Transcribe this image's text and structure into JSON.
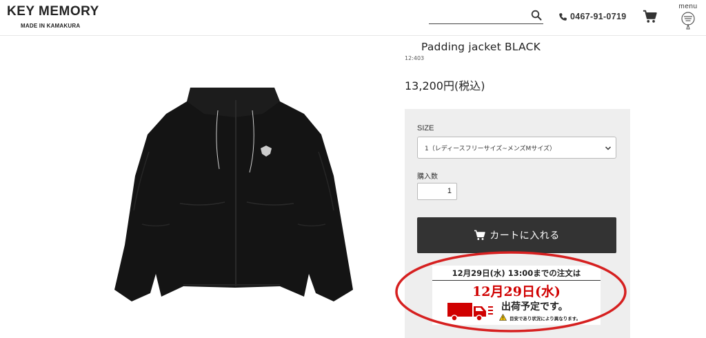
{
  "header": {
    "logo_title": "KEY MEMORY",
    "logo_subtitle": "MADE IN KAMAKURA",
    "search": {
      "value": "",
      "placeholder": "",
      "icon": "search-icon"
    },
    "phone": {
      "icon": "phone-icon",
      "number": "0467-91-0719"
    },
    "cart": {
      "icon": "cart-icon"
    },
    "menu": {
      "label": "menu",
      "icon": "menu-icon"
    }
  },
  "product": {
    "image_icon": "jacket-image",
    "name": "Padding jacket BLACK",
    "code": "12:403",
    "price": "13,200円(税込)",
    "size": {
      "label": "SIZE",
      "selected": "1（レディースフリーサイズ~メンズMサイズ）"
    },
    "quantity": {
      "label": "購入数",
      "value": "1"
    },
    "add_to_cart_label": "カートに入れる"
  },
  "shipping_notice": {
    "deadline": "12月29日(水) 13:00までの注文は",
    "date": "12月29日(水)",
    "label": "出荷予定です。",
    "note": "目安であり状況により異なります。",
    "accent_color": "#d00000"
  },
  "colors": {
    "button_bg": "#333333",
    "panel_bg": "#eeeeee",
    "highlight": "#d62020"
  }
}
